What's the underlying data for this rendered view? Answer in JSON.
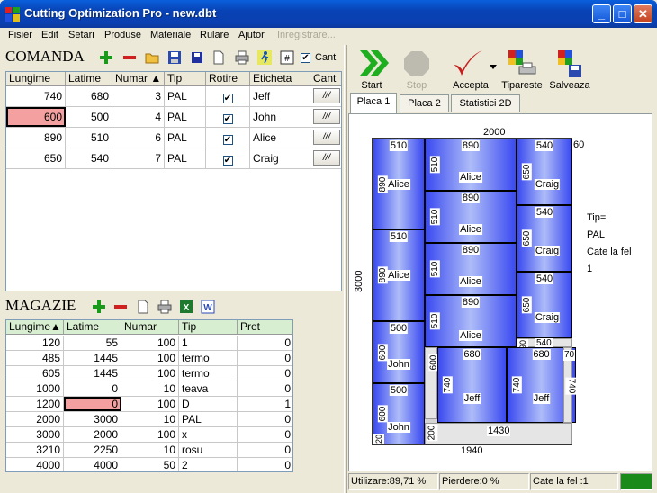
{
  "window": {
    "title": "Cutting Optimization Pro - new.dbt",
    "min": "_",
    "max": "□",
    "close": "✕"
  },
  "menu": [
    "Fisier",
    "Edit",
    "Setari",
    "Produse",
    "Materiale",
    "Rulare",
    "Ajutor",
    "Inregistrare..."
  ],
  "comanda": {
    "title": "COMANDA",
    "cant_checkbox_label": "Cant",
    "headers": [
      "Lungime",
      "Latime",
      "Numar ▲",
      "Tip",
      "Rotire",
      "Eticheta",
      "Cant"
    ],
    "rows": [
      {
        "lungime": "740",
        "latime": "680",
        "numar": "3",
        "tip": "PAL",
        "rotire": "✔",
        "eticheta": "Jeff",
        "cant": "///"
      },
      {
        "lungime": "600",
        "latime": "500",
        "numar": "4",
        "tip": "PAL",
        "rotire": "✔",
        "eticheta": "John",
        "cant": "///"
      },
      {
        "lungime": "890",
        "latime": "510",
        "numar": "6",
        "tip": "PAL",
        "rotire": "✔",
        "eticheta": "Alice",
        "cant": "///"
      },
      {
        "lungime": "650",
        "latime": "540",
        "numar": "7",
        "tip": "PAL",
        "rotire": "✔",
        "eticheta": "Craig",
        "cant": "///"
      }
    ]
  },
  "magazie": {
    "title": "MAGAZIE",
    "headers": [
      "Lungime▲",
      "Latime",
      "Numar",
      "Tip",
      "Pret"
    ],
    "rows": [
      {
        "lungime": "120",
        "latime": "55",
        "numar": "100",
        "tip": "1",
        "pret": "0"
      },
      {
        "lungime": "485",
        "latime": "1445",
        "numar": "100",
        "tip": "termo",
        "pret": "0"
      },
      {
        "lungime": "605",
        "latime": "1445",
        "numar": "100",
        "tip": "termo",
        "pret": "0"
      },
      {
        "lungime": "1000",
        "latime": "0",
        "numar": "10",
        "tip": "teava",
        "pret": "0"
      },
      {
        "lungime": "1200",
        "latime": "0",
        "numar": "100",
        "tip": "D",
        "pret": "1"
      },
      {
        "lungime": "2000",
        "latime": "3000",
        "numar": "10",
        "tip": "PAL",
        "pret": "0"
      },
      {
        "lungime": "3000",
        "latime": "2000",
        "numar": "100",
        "tip": "x",
        "pret": "0"
      },
      {
        "lungime": "3210",
        "latime": "2250",
        "numar": "10",
        "tip": "rosu",
        "pret": "0"
      },
      {
        "lungime": "4000",
        "latime": "4000",
        "numar": "50",
        "tip": "2",
        "pret": "0"
      }
    ]
  },
  "toolbar": {
    "start": "Start",
    "stop": "Stop",
    "accepta": "Accepta",
    "tipareste": "Tipareste",
    "salveaza": "Salveaza"
  },
  "tabs": [
    "Placa 1",
    "Placa 2",
    "Statistici 2D"
  ],
  "layout": {
    "sheet_width": "2000",
    "sheet_height": "3000",
    "sheet_height_right": "3000",
    "bottom_label": "1940",
    "right_top_label": "60",
    "info": {
      "tip_label": "Tip=",
      "tip_value": "PAL",
      "cate_label": "Cate la fel",
      "cate_value": "1"
    },
    "pieces": [
      {
        "w": "510",
        "h": "890",
        "name": "Alice"
      },
      {
        "w": "510",
        "h": "890",
        "name": "Alice"
      },
      {
        "w": "500",
        "h": "600",
        "name": "John"
      },
      {
        "w": "500",
        "h": "600",
        "name": "John"
      },
      {
        "w": "890",
        "h": "510",
        "name": "Alice"
      },
      {
        "w": "890",
        "h": "510",
        "name": "Alice"
      },
      {
        "w": "890",
        "h": "510",
        "name": "Alice"
      },
      {
        "w": "890",
        "h": "510",
        "name": "Alice"
      },
      {
        "w": "540",
        "h": "650",
        "name": "Craig"
      },
      {
        "w": "540",
        "h": "650",
        "name": "Craig"
      },
      {
        "w": "540",
        "h": "650",
        "name": "Craig"
      },
      {
        "w": "680",
        "h": "740",
        "name": "Jeff"
      },
      {
        "w": "680",
        "h": "740",
        "name": "Jeff"
      }
    ],
    "waste": {
      "w540": "540",
      "h90": "90",
      "h600": "600",
      "w1430": "1430",
      "h200": "200",
      "h70": "70",
      "h740": "740",
      "h20": "20"
    }
  },
  "status": {
    "utilizare": "Utilizare:89,71 %",
    "pierdere": "Pierdere:0 %",
    "cate": "Cate la fel :1"
  },
  "colors": {
    "title_bar": "#0a4ad0",
    "piece_dark": "#3a4af0",
    "piece_light": "#aebcf8",
    "selected_cell": "#f4a0a0",
    "status_ok": "#1a8a1a"
  }
}
